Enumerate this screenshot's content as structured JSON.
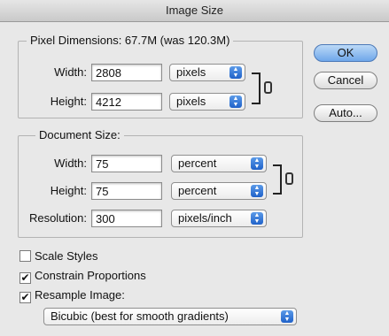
{
  "window": {
    "title": "Image Size"
  },
  "pixel_dimensions": {
    "legend": "Pixel Dimensions:  67.7M (was 120.3M)",
    "width_label": "Width:",
    "width_value": "2808",
    "width_unit": "pixels",
    "height_label": "Height:",
    "height_value": "4212",
    "height_unit": "pixels"
  },
  "document_size": {
    "legend": "Document Size:",
    "width_label": "Width:",
    "width_value": "75",
    "width_unit": "percent",
    "height_label": "Height:",
    "height_value": "75",
    "height_unit": "percent",
    "resolution_label": "Resolution:",
    "resolution_value": "300",
    "resolution_unit": "pixels/inch"
  },
  "buttons": {
    "ok": "OK",
    "cancel": "Cancel",
    "auto": "Auto..."
  },
  "options": {
    "scale_styles": {
      "label": "Scale Styles",
      "checked": false
    },
    "constrain_proportions": {
      "label": "Constrain Proportions",
      "checked": true
    },
    "resample_image": {
      "label": "Resample Image:",
      "checked": true
    },
    "resample_method": "Bicubic (best for smooth gradients)"
  },
  "icons": {
    "check": "✔",
    "updown": "▲▼"
  }
}
